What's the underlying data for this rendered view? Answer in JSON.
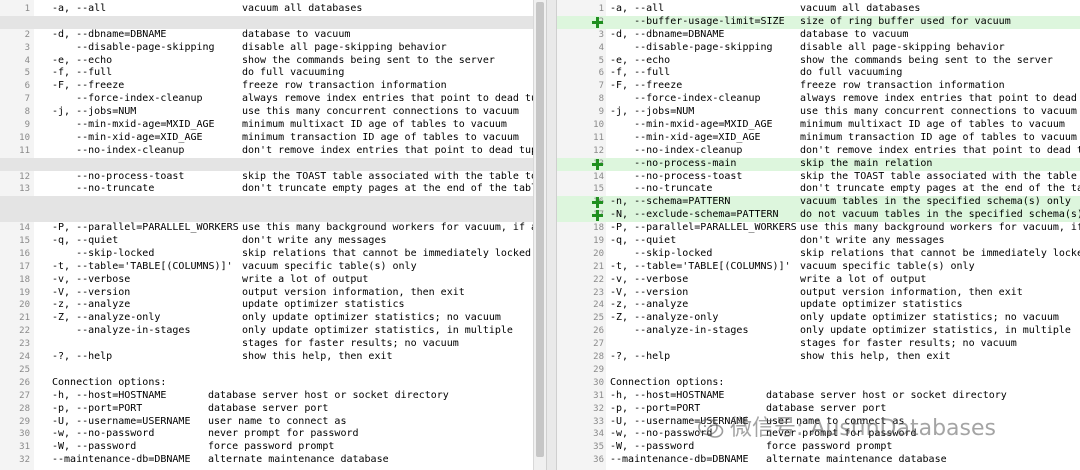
{
  "left_pane": {
    "lines": [
      {
        "n": "1",
        "opt": "-a, --all",
        "desc": "vacuum all databases",
        "kind": "normal"
      },
      {
        "n": "",
        "opt": "",
        "desc": "",
        "kind": "placeholder"
      },
      {
        "n": "2",
        "opt": "-d, --dbname=DBNAME",
        "desc": "database to vacuum",
        "kind": "normal"
      },
      {
        "n": "3",
        "opt": "    --disable-page-skipping",
        "desc": "disable all page-skipping behavior",
        "kind": "normal"
      },
      {
        "n": "4",
        "opt": "-e, --echo",
        "desc": "show the commands being sent to the server",
        "kind": "normal"
      },
      {
        "n": "5",
        "opt": "-f, --full",
        "desc": "do full vacuuming",
        "kind": "normal"
      },
      {
        "n": "6",
        "opt": "-F, --freeze",
        "desc": "freeze row transaction information",
        "kind": "normal"
      },
      {
        "n": "7",
        "opt": "    --force-index-cleanup",
        "desc": "always remove index entries that point to dead tupl",
        "kind": "normal"
      },
      {
        "n": "8",
        "opt": "-j, --jobs=NUM",
        "desc": "use this many concurrent connections to vacuum",
        "kind": "normal"
      },
      {
        "n": "9",
        "opt": "    --min-mxid-age=MXID_AGE",
        "desc": "minimum multixact ID age of tables to vacuum",
        "kind": "normal"
      },
      {
        "n": "10",
        "opt": "    --min-xid-age=XID_AGE",
        "desc": "minimum transaction ID age of tables to vacuum",
        "kind": "normal"
      },
      {
        "n": "11",
        "opt": "    --no-index-cleanup",
        "desc": "don't remove index entries that point to dead tuple",
        "kind": "normal"
      },
      {
        "n": "",
        "opt": "",
        "desc": "",
        "kind": "placeholder"
      },
      {
        "n": "12",
        "opt": "    --no-process-toast",
        "desc": "skip the TOAST table associated with the table to v",
        "kind": "normal"
      },
      {
        "n": "13",
        "opt": "    --no-truncate",
        "desc": "don't truncate empty pages at the end of the table",
        "kind": "normal"
      },
      {
        "n": "",
        "opt": "",
        "desc": "",
        "kind": "placeholder"
      },
      {
        "n": "",
        "opt": "",
        "desc": "",
        "kind": "placeholder"
      },
      {
        "n": "14",
        "opt": "-P, --parallel=PARALLEL_WORKERS",
        "desc": "use this many background workers for vacuum, if ava",
        "kind": "normal"
      },
      {
        "n": "15",
        "opt": "-q, --quiet",
        "desc": "don't write any messages",
        "kind": "normal"
      },
      {
        "n": "16",
        "opt": "    --skip-locked",
        "desc": "skip relations that cannot be immediately locked",
        "kind": "normal"
      },
      {
        "n": "17",
        "opt": "-t, --table='TABLE[(COLUMNS)]'",
        "desc": "vacuum specific table(s) only",
        "kind": "normal"
      },
      {
        "n": "18",
        "opt": "-v, --verbose",
        "desc": "write a lot of output",
        "kind": "normal"
      },
      {
        "n": "19",
        "opt": "-V, --version",
        "desc": "output version information, then exit",
        "kind": "normal"
      },
      {
        "n": "20",
        "opt": "-z, --analyze",
        "desc": "update optimizer statistics",
        "kind": "normal"
      },
      {
        "n": "21",
        "opt": "-Z, --analyze-only",
        "desc": "only update optimizer statistics; no vacuum",
        "kind": "normal"
      },
      {
        "n": "22",
        "opt": "    --analyze-in-stages",
        "desc": "only update optimizer statistics, in multiple",
        "kind": "normal"
      },
      {
        "n": "23",
        "opt": "",
        "desc": "stages for faster results; no vacuum",
        "kind": "normal"
      },
      {
        "n": "24",
        "opt": "-?, --help",
        "desc": "show this help, then exit",
        "kind": "normal"
      },
      {
        "n": "25",
        "opt": "",
        "desc": "",
        "kind": "normal"
      },
      {
        "n": "26",
        "opt": "Connection options:",
        "desc": "",
        "kind": "head"
      },
      {
        "n": "27",
        "opt": "-h, --host=HOSTNAME",
        "desc": "database server host or socket directory",
        "kind": "conn"
      },
      {
        "n": "28",
        "opt": "-p, --port=PORT",
        "desc": "database server port",
        "kind": "conn"
      },
      {
        "n": "29",
        "opt": "-U, --username=USERNAME",
        "desc": "user name to connect as",
        "kind": "conn"
      },
      {
        "n": "30",
        "opt": "-w, --no-password",
        "desc": "never prompt for password",
        "kind": "conn"
      },
      {
        "n": "31",
        "opt": "-W, --password",
        "desc": "force password prompt",
        "kind": "conn"
      },
      {
        "n": "32",
        "opt": "--maintenance-db=DBNAME",
        "desc": "alternate maintenance database",
        "kind": "conn"
      }
    ]
  },
  "right_pane": {
    "lines": [
      {
        "n": "1",
        "opt": "-a, --all",
        "desc": "vacuum all databases",
        "kind": "normal"
      },
      {
        "n": "2",
        "opt": "    --buffer-usage-limit=SIZE",
        "desc": "size of ring buffer used for vacuum",
        "kind": "added"
      },
      {
        "n": "3",
        "opt": "-d, --dbname=DBNAME",
        "desc": "database to vacuum",
        "kind": "normal"
      },
      {
        "n": "4",
        "opt": "    --disable-page-skipping",
        "desc": "disable all page-skipping behavior",
        "kind": "normal"
      },
      {
        "n": "5",
        "opt": "-e, --echo",
        "desc": "show the commands being sent to the server",
        "kind": "normal"
      },
      {
        "n": "6",
        "opt": "-f, --full",
        "desc": "do full vacuuming",
        "kind": "normal"
      },
      {
        "n": "7",
        "opt": "-F, --freeze",
        "desc": "freeze row transaction information",
        "kind": "normal"
      },
      {
        "n": "8",
        "opt": "    --force-index-cleanup",
        "desc": "always remove index entries that point to dead tupl",
        "kind": "normal"
      },
      {
        "n": "9",
        "opt": "-j, --jobs=NUM",
        "desc": "use this many concurrent connections to vacuum",
        "kind": "normal"
      },
      {
        "n": "10",
        "opt": "    --min-mxid-age=MXID_AGE",
        "desc": "minimum multixact ID age of tables to vacuum",
        "kind": "normal"
      },
      {
        "n": "11",
        "opt": "    --min-xid-age=XID_AGE",
        "desc": "minimum transaction ID age of tables to vacuum",
        "kind": "normal"
      },
      {
        "n": "12",
        "opt": "    --no-index-cleanup",
        "desc": "don't remove index entries that point to dead tuple",
        "kind": "normal"
      },
      {
        "n": "13",
        "opt": "    --no-process-main",
        "desc": "skip the main relation",
        "kind": "added"
      },
      {
        "n": "14",
        "opt": "    --no-process-toast",
        "desc": "skip the TOAST table associated with the table to",
        "kind": "normal"
      },
      {
        "n": "15",
        "opt": "    --no-truncate",
        "desc": "don't truncate empty pages at the end of the table",
        "kind": "normal"
      },
      {
        "n": "16",
        "opt": "-n, --schema=PATTERN",
        "desc": "vacuum tables in the specified schema(s) only",
        "kind": "added"
      },
      {
        "n": "17",
        "opt": "-N, --exclude-schema=PATTERN",
        "desc": "do not vacuum tables in the specified schema(s)",
        "kind": "added"
      },
      {
        "n": "18",
        "opt": "-P, --parallel=PARALLEL_WORKERS",
        "desc": "use this many background workers for vacuum, if ava",
        "kind": "normal"
      },
      {
        "n": "19",
        "opt": "-q, --quiet",
        "desc": "don't write any messages",
        "kind": "normal"
      },
      {
        "n": "20",
        "opt": "    --skip-locked",
        "desc": "skip relations that cannot be immediately locked",
        "kind": "normal"
      },
      {
        "n": "21",
        "opt": "-t, --table='TABLE[(COLUMNS)]'",
        "desc": "vacuum specific table(s) only",
        "kind": "normal"
      },
      {
        "n": "22",
        "opt": "-v, --verbose",
        "desc": "write a lot of output",
        "kind": "normal"
      },
      {
        "n": "23",
        "opt": "-V, --version",
        "desc": "output version information, then exit",
        "kind": "normal"
      },
      {
        "n": "24",
        "opt": "-z, --analyze",
        "desc": "update optimizer statistics",
        "kind": "normal"
      },
      {
        "n": "25",
        "opt": "-Z, --analyze-only",
        "desc": "only update optimizer statistics; no vacuum",
        "kind": "normal"
      },
      {
        "n": "26",
        "opt": "    --analyze-in-stages",
        "desc": "only update optimizer statistics, in multiple",
        "kind": "normal"
      },
      {
        "n": "27",
        "opt": "",
        "desc": "stages for faster results; no vacuum",
        "kind": "normal"
      },
      {
        "n": "28",
        "opt": "-?, --help",
        "desc": "show this help, then exit",
        "kind": "normal"
      },
      {
        "n": "29",
        "opt": "",
        "desc": "",
        "kind": "normal"
      },
      {
        "n": "30",
        "opt": "Connection options:",
        "desc": "",
        "kind": "head"
      },
      {
        "n": "31",
        "opt": "-h, --host=HOSTNAME",
        "desc": "database server host or socket directory",
        "kind": "conn"
      },
      {
        "n": "32",
        "opt": "-p, --port=PORT",
        "desc": "database server port",
        "kind": "conn"
      },
      {
        "n": "33",
        "opt": "-U, --username=USERNAME",
        "desc": "user name to connect as",
        "kind": "conn"
      },
      {
        "n": "34",
        "opt": "-w, --no-password",
        "desc": "never prompt for password",
        "kind": "conn"
      },
      {
        "n": "35",
        "opt": "-W, --password",
        "desc": "force password prompt",
        "kind": "conn"
      },
      {
        "n": "36",
        "opt": "--maintenance-db=DBNAME",
        "desc": "alternate maintenance database",
        "kind": "conn"
      }
    ]
  },
  "watermark": {
    "text": "微信号: AustinDatabases",
    "icon": "wechat-icon"
  },
  "colors": {
    "added_bg": "#ddf6dd",
    "placeholder_bg": "#e4e4e4",
    "marker": "#1f8f1f",
    "gutter": "#f4f4f4"
  }
}
